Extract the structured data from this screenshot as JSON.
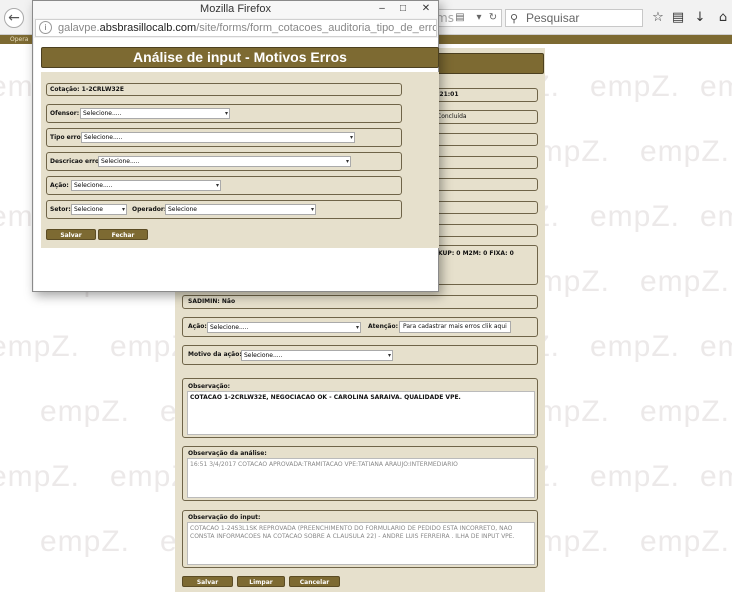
{
  "browser": {
    "url_tail": "ms",
    "search_placeholder": "Pesquisar",
    "menu_label": "Opera"
  },
  "watermark": "empZ.",
  "main_form": {
    "time_value": ":21:01",
    "status_value": "Concluída",
    "counts_text": "KUP: 0    M2M: 0    FIXA: 0",
    "sadimin": "SADIMIN: Não",
    "acao_label": "Ação:",
    "acao_value": "Selecione.....",
    "atencao_label": "Atenção:",
    "atencao_button": "Para cadastrar mais erros clik aqui",
    "motivo_label": "Motivo da ação:",
    "motivo_value": "Selecione.....",
    "observacao_label": "Observação:",
    "observacao_value": "COTACAO 1-2CRLW32E, NEGOCIACAO OK - CAROLINA SARAIVA. QUALIDADE VPE.",
    "obs_analise_label": "Observação da análise:",
    "obs_analise_value": "16:51 3/4/2017 COTACAO APROVADA:TRAMITACAO VPE:TATIANA ARAUJO:INTERMEDIARIO",
    "obs_input_label": "Observação do input:",
    "obs_input_value": "COTACAO 1-24S3L1SK REPROVADA (PREENCHIMENTO DO FORMULARIO DE PEDIDO ESTA INCORRETO, NAO CONSTA INFORMACOES NA COTACAO SOBRE A CLAUSULA 22) - ANDRE LUIS FERREIRA . ILHA DE INPUT VPE.",
    "salvar": "Salvar",
    "limpar": "Limpar",
    "cancelar": "Cancelar"
  },
  "popup": {
    "window_title": "Mozilla Firefox",
    "url_prefix": "galavpe.",
    "url_domain": "absbrasillocalb.com",
    "url_path": "/site/forms/form_cotacoes_auditoria_tipo_de_erros.php?id",
    "heading": "Análise de input - Motivos Erros",
    "cotacao": "Cotação: 1-2CRLW32E",
    "ofensor_label": "Ofensor:",
    "ofensor_value": "Selecione.....",
    "tipo_erro_label": "Tipo erro:",
    "tipo_erro_value": "Selecione.....",
    "descricao_label": "Descricao erro:",
    "descricao_value": "Selecione.....",
    "acao_label": "Ação:",
    "acao_value": "Selecione.....",
    "setor_label": "Setor:",
    "setor_value": "Selecione",
    "operador_label": "Operador:",
    "operador_value": "Selecione",
    "salvar": "Salvar",
    "fechar": "Fechar"
  }
}
